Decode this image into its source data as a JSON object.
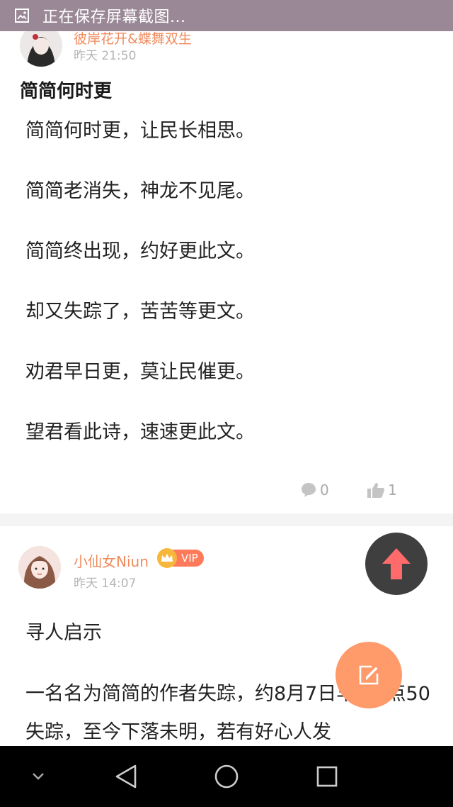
{
  "status_bar": {
    "text": "正在保存屏幕截图...",
    "icon": "screenshot-icon",
    "background": "#9a8896"
  },
  "post1": {
    "author": "彼岸花开&蝶舞双生",
    "time": "昨天 21:50",
    "title": "简简何时更",
    "lines": [
      "简简何时更，让民长相思。",
      "简简老消失，神龙不见尾。",
      "简简终出现，约好更此文。",
      "却又失踪了，苦苦等更文。",
      "劝君早日更，莫让民催更。",
      "望君看此诗，速速更此文。"
    ],
    "comments": "0",
    "likes": "1"
  },
  "post2": {
    "author": "小仙女Niun",
    "vip_label": "VIP",
    "time": "昨天 14:07",
    "heading": "寻人启示",
    "body": "一名名为简简的作者失踪，约8月7日早晨8点50失踪，至今下落未明，若有好心人发"
  },
  "colors": {
    "accent": "#f08a5d",
    "fab_edit": "#ff9a6b",
    "fab_top": "#3f3f3f",
    "arrow": "#ff6b6b"
  },
  "nav_icons": [
    "chevron-down-icon",
    "back-icon",
    "home-icon",
    "recents-icon"
  ]
}
